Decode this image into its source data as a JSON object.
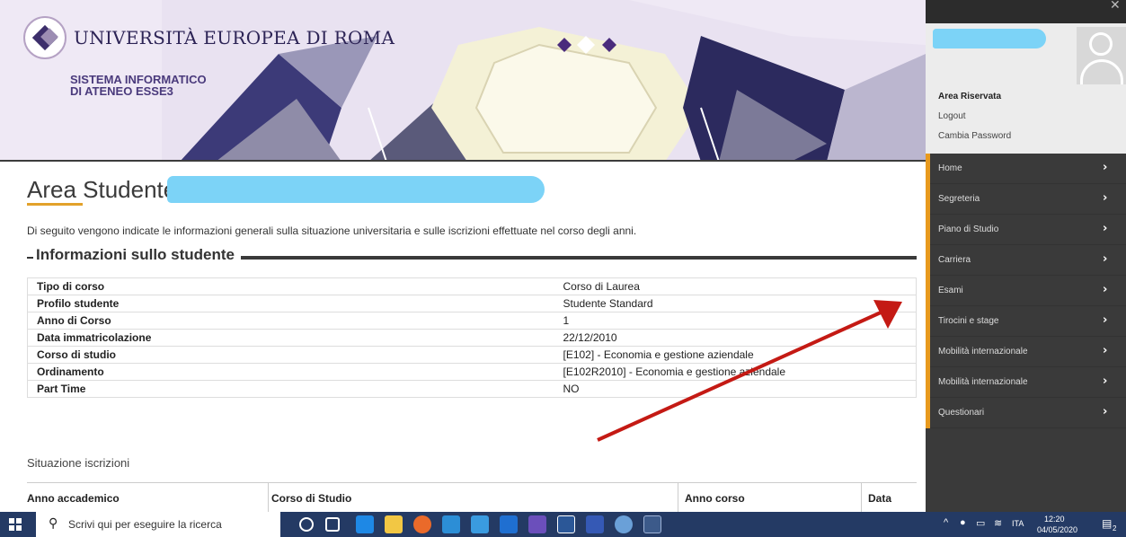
{
  "header": {
    "university_name": "UNIVERSITÀ EUROPEA DI ROMA",
    "system_line1": "SISTEMA INFORMATICO",
    "system_line2": "DI ATENEO ESSE3"
  },
  "page": {
    "title": "Area Studente",
    "intro": "Di seguito vengono indicate le informazioni generali sulla situazione universitaria e sulle iscrizioni effettuate nel corso degli anni.",
    "section_title": "Informazioni sullo studente"
  },
  "student_info": [
    {
      "key": "Tipo di corso",
      "value": "Corso di Laurea"
    },
    {
      "key": "Profilo studente",
      "value": "Studente Standard"
    },
    {
      "key": "Anno di Corso",
      "value": "1"
    },
    {
      "key": "Data immatricolazione",
      "value": "22/12/2010"
    },
    {
      "key": "Corso di studio",
      "value": "[E102] - Economia e gestione aziendale"
    },
    {
      "key": "Ordinamento",
      "value": "[E102R2010] - Economia e gestione aziendale"
    },
    {
      "key": "Part Time",
      "value": "NO"
    }
  ],
  "iscrizioni": {
    "title": "Situazione iscrizioni",
    "columns": [
      "Anno accademico",
      "Corso di Studio",
      "Anno corso",
      "Data"
    ]
  },
  "drawer": {
    "area_riservata": "Area Riservata",
    "logout": "Logout",
    "cambia_password": "Cambia Password",
    "close_glyph": "✕",
    "menu": [
      {
        "label": "Home"
      },
      {
        "label": "Segreteria"
      },
      {
        "label": "Piano di Studio"
      },
      {
        "label": "Carriera"
      },
      {
        "label": "Esami"
      },
      {
        "label": "Tirocini e stage"
      },
      {
        "label": "Mobilità internazionale"
      },
      {
        "label": "Mobilità internazionale"
      },
      {
        "label": "Questionari"
      }
    ],
    "accent_color": "#e89a1e"
  },
  "taskbar": {
    "search_placeholder": "Scrivi qui per eseguire la ricerca",
    "language": "ITA",
    "time": "12:20",
    "date": "04/05/2020",
    "notification_count": "2"
  }
}
